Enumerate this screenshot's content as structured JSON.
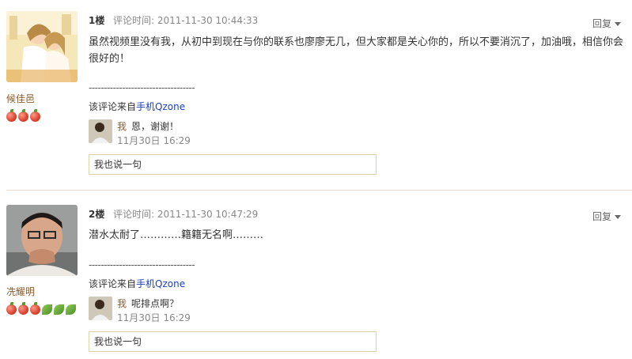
{
  "comments": [
    {
      "user": "候佳邑",
      "floor": "1楼",
      "time": "评论时间: 2011-11-30 10:44:33",
      "reply_label": "回复",
      "text": "虽然视频里没有我，从初中到现在与你的联系也廖廖无几，但大家都是关心你的，所以不要消沉了，加油哦，相信你会很好的！",
      "dashes": "-----------------------------------",
      "source_prefix": "该评论来自",
      "source_link": "手机Qzone",
      "badges": [
        "apple",
        "apple",
        "apple"
      ],
      "subreply": {
        "user": "我",
        "text": "恩，谢谢！",
        "date": "11月30日 16:29"
      },
      "say_label": "我也说一句"
    },
    {
      "user": "冼耀明",
      "floor": "2楼",
      "time": "评论时间: 2011-11-30 10:47:29",
      "reply_label": "回复",
      "text": "潜水太耐了…………籍籍无名啊………",
      "dashes": "-----------------------------------",
      "source_prefix": "该评论来自",
      "source_link": "手机Qzone",
      "badges": [
        "apple",
        "apple",
        "apple",
        "leaf",
        "leaf",
        "leaf"
      ],
      "subreply": {
        "user": "我",
        "text": "呢排点啊？",
        "date": "11月30日 16:29"
      },
      "say_label": "我也说一句"
    }
  ]
}
